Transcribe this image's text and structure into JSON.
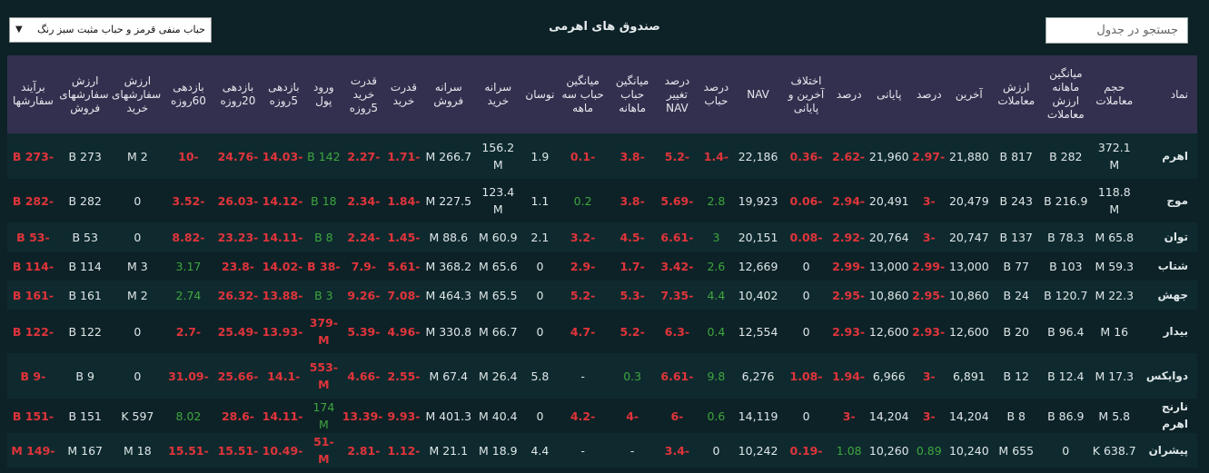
{
  "title": "صندوق های اهرمی",
  "filter": {
    "selected": "حباب منفی قرمز و حباب مثبت سبز رنگ"
  },
  "search": {
    "placeholder": "جستجو در جدول"
  },
  "colors": {
    "negative": "#e0343b",
    "positive": "#3fa63f",
    "header_bg": "#33304f",
    "page_bg": "#0c2226"
  },
  "table": {
    "headers": [
      "نماد",
      "حجم معاملات",
      "میانگین ماهانه ارزش معاملات",
      "ارزش معاملات",
      "آخرین",
      "درصد",
      "پایانی",
      "درصد",
      "اختلاف آخرین و پایانی",
      "NAV",
      "درصد حباب",
      "درصد تغییر NAV",
      "میانگین حباب ماهانه",
      "میانگین حباب سه ماهه",
      "نوسان",
      "سرانه خرید",
      "سرانه فروش",
      "قدرت خرید",
      "قدرت خرید 5روزه",
      "ورود پول",
      "بازدهی 5روزه",
      "بازدهی 20روزه",
      "بازدهی 60روزه",
      "ارزش سفارشهای خرید",
      "ارزش سفارشهای فروش",
      "برآیند سفارشها"
    ],
    "rows": [
      [
        "اهرم",
        "372.1 M",
        "282 B",
        "817 B",
        "21,880",
        "-2.97",
        "21,960",
        "-2.62",
        "-0.36",
        "22,186",
        "-1.4",
        "-5.2",
        "-3.8",
        "-0.1",
        "1.9",
        "156.2 M",
        "266.7 M",
        "-1.71",
        "-2.27",
        "142 B",
        "-14.03",
        "-24.76",
        "-10",
        "2 M",
        "273 B",
        "-273 B"
      ],
      [
        "موج",
        "118.8 M",
        "216.9 B",
        "243 B",
        "20,479",
        "-3",
        "20,491",
        "-2.94",
        "-0.06",
        "19,923",
        "2.8",
        "-5.69",
        "-3.8",
        "0.2",
        "1.1",
        "123.4 M",
        "227.5 M",
        "-1.84",
        "-2.34",
        "18 B",
        "-14.12",
        "-26.03",
        "-3.52",
        "0",
        "282 B",
        "-282 B"
      ],
      [
        "توان",
        "65.8 M",
        "78.3 B",
        "137 B",
        "20,747",
        "-3",
        "20,764",
        "-2.92",
        "-0.08",
        "20,151",
        "3",
        "-6.61",
        "-4.5",
        "-3.2",
        "2.1",
        "60.9 M",
        "88.6 M",
        "-1.45",
        "-2.24",
        "8 B",
        "-14.11",
        "-23.23",
        "-8.82",
        "0",
        "53 B",
        "-53 B"
      ],
      [
        "شتاب",
        "59.3 M",
        "103 B",
        "77 B",
        "13,000",
        "-2.99",
        "13,000",
        "-2.99",
        "0",
        "12,669",
        "2.6",
        "-3.42",
        "-1.7",
        "-2.9",
        "0",
        "65.6 M",
        "368.2 M",
        "-5.61",
        "-7.9",
        "-38 B",
        "-14.02",
        "-23.8",
        "3.17",
        "3 M",
        "114 B",
        "-114 B"
      ],
      [
        "جهش",
        "22.3 M",
        "120.7 B",
        "24 B",
        "10,860",
        "-2.95",
        "10,860",
        "-2.95",
        "0",
        "10,402",
        "4.4",
        "-7.35",
        "-5.3",
        "-5.2",
        "0",
        "65.5 M",
        "464.3 M",
        "-7.08",
        "-9.26",
        "3 B",
        "-13.88",
        "-26.32",
        "2.74",
        "2 M",
        "161 B",
        "-161 B"
      ],
      [
        "بیدار",
        "16 M",
        "96.4 B",
        "20 B",
        "12,600",
        "-2.93",
        "12,600",
        "-2.93",
        "0",
        "12,554",
        "0.4",
        "-6.3",
        "-5.2",
        "-4.7",
        "0",
        "66.7 M",
        "330.8 M",
        "-4.96",
        "-5.39",
        "-379 M",
        "-13.93",
        "-25.49",
        "-2.7",
        "0",
        "122 B",
        "-122 B"
      ],
      [
        "دوایکس",
        "17.3 M",
        "12.4 B",
        "12 B",
        "6,891",
        "-3",
        "6,966",
        "-1.94",
        "-1.08",
        "6,276",
        "9.8",
        "-6.61",
        "0.3",
        "-",
        "5.8",
        "26.4 M",
        "67.4 M",
        "-2.55",
        "-4.66",
        "-553 M",
        "-14.1",
        "-25.66",
        "-31.09",
        "0",
        "9 B",
        "-9 B"
      ],
      [
        "نارنج اهرم",
        "5.8 M",
        "86.9 B",
        "8 B",
        "14,204",
        "-3",
        "14,204",
        "-3",
        "0",
        "14,119",
        "0.6",
        "-6",
        "-4",
        "-4.2",
        "0",
        "40.4 M",
        "401.3 M",
        "-9.93",
        "-13.39",
        "174 M",
        "-14.11",
        "-28.6",
        "8.02",
        "597 K",
        "151 B",
        "-151 B"
      ],
      [
        "پیشران",
        "638.7 K",
        "0",
        "655 M",
        "10,240",
        "0.89",
        "10,260",
        "1.08",
        "-0.19",
        "10,242",
        "0",
        "-3.4",
        "-",
        "-",
        "4.4",
        "18.9 M",
        "21.1 M",
        "-1.12",
        "-2.81",
        "-51 M",
        "-10.49",
        "-15.51",
        "-15.51",
        "18 M",
        "167 M",
        "-149 M"
      ]
    ]
  }
}
